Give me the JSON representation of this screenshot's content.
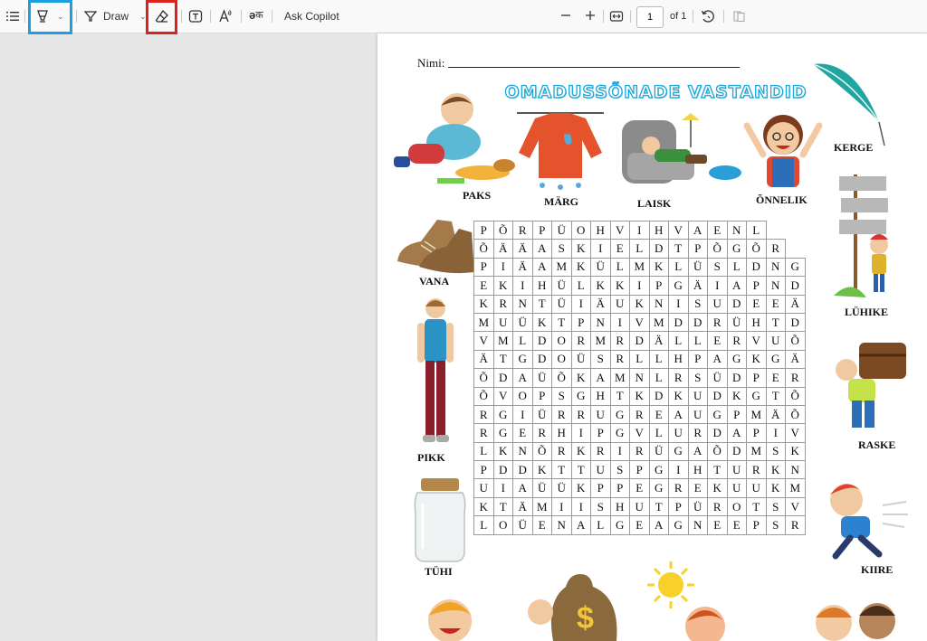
{
  "toolbar": {
    "draw_label": "Draw",
    "ask_copilot_label": "Ask Copilot",
    "page_number": "1",
    "page_total": "of 1",
    "highlight_color": "#1a9fe0",
    "eraser_highlight_color": "#e0201b"
  },
  "worksheet": {
    "name_label": "Nimi:",
    "title": "OMADUSSÕNADE VASTANDID",
    "title_color": "#1aa6d6",
    "labels": {
      "paks": "PAKS",
      "marg": "MÄRG",
      "laisk": "LAISK",
      "onnelik": "ÕNNELIK",
      "kerge": "KERGE",
      "vana": "VANA",
      "luhike": "LÜHIKE",
      "pikk": "PIKK",
      "raske": "RASKE",
      "tuhi": "TÜHI",
      "kiire": "KIIRE"
    },
    "grid": [
      [
        "P",
        "Õ",
        "R",
        "P",
        "Ü",
        "O",
        "H",
        "V",
        "I",
        "H",
        "V",
        "A",
        "E",
        "N",
        "L"
      ],
      [
        "Õ",
        "Ä",
        "Ä",
        "A",
        "S",
        "K",
        "I",
        "E",
        "L",
        "D",
        "T",
        "P",
        "Õ",
        "G",
        "Õ",
        "R"
      ],
      [
        "P",
        "I",
        "Ä",
        "A",
        "M",
        "K",
        "Ü",
        "L",
        "M",
        "K",
        "L",
        "Ü",
        "S",
        "L",
        "D",
        "N",
        "G"
      ],
      [
        "E",
        "K",
        "I",
        "H",
        "Ü",
        "L",
        "K",
        "K",
        "I",
        "P",
        "G",
        "Ä",
        "I",
        "A",
        "P",
        "N",
        "D"
      ],
      [
        "K",
        "R",
        "N",
        "T",
        "Ü",
        "I",
        "Ä",
        "U",
        "K",
        "N",
        "I",
        "S",
        "U",
        "D",
        "E",
        "E",
        "Ä"
      ],
      [
        "M",
        "U",
        "Ü",
        "K",
        "T",
        "P",
        "N",
        "I",
        "V",
        "M",
        "D",
        "D",
        "R",
        "Ü",
        "H",
        "T",
        "D"
      ],
      [
        "V",
        "M",
        "L",
        "D",
        "O",
        "R",
        "M",
        "R",
        "D",
        "Ä",
        "L",
        "L",
        "E",
        "R",
        "V",
        "U",
        "Õ"
      ],
      [
        "Ä",
        "T",
        "G",
        "D",
        "O",
        "Ü",
        "S",
        "R",
        "L",
        "L",
        "H",
        "P",
        "A",
        "G",
        "K",
        "G",
        "Ä"
      ],
      [
        "Õ",
        "D",
        "A",
        "Ü",
        "Õ",
        "K",
        "A",
        "M",
        "N",
        "L",
        "R",
        "S",
        "Ü",
        "D",
        "P",
        "E",
        "R"
      ],
      [
        "Õ",
        "V",
        "O",
        "P",
        "S",
        "G",
        "H",
        "T",
        "K",
        "D",
        "K",
        "U",
        "D",
        "K",
        "G",
        "T",
        "Õ"
      ],
      [
        "R",
        "G",
        "I",
        "Ü",
        "R",
        "R",
        "U",
        "G",
        "R",
        "E",
        "A",
        "U",
        "G",
        "P",
        "M",
        "Ä",
        "Õ"
      ],
      [
        "R",
        "G",
        "E",
        "R",
        "H",
        "I",
        "P",
        "G",
        "V",
        "L",
        "U",
        "R",
        "D",
        "A",
        "P",
        "I",
        "V"
      ],
      [
        "L",
        "K",
        "N",
        "Õ",
        "R",
        "K",
        "R",
        "I",
        "R",
        "Ü",
        "G",
        "A",
        "Õ",
        "D",
        "M",
        "S",
        "K"
      ],
      [
        "P",
        "D",
        "D",
        "K",
        "T",
        "T",
        "U",
        "S",
        "P",
        "G",
        "I",
        "H",
        "T",
        "U",
        "R",
        "K",
        "N"
      ],
      [
        "U",
        "I",
        "A",
        "Ü",
        "Ü",
        "K",
        "P",
        "P",
        "E",
        "G",
        "R",
        "E",
        "K",
        "U",
        "U",
        "K",
        "M"
      ],
      [
        "K",
        "T",
        "Ä",
        "M",
        "I",
        "I",
        "S",
        "H",
        "U",
        "T",
        "P",
        "Ü",
        "R",
        "O",
        "T",
        "S",
        "V"
      ],
      [
        "L",
        "O",
        "Ü",
        "E",
        "N",
        "A",
        "L",
        "G",
        "E",
        "A",
        "G",
        "N",
        "E",
        "E",
        "P",
        "S",
        "R"
      ]
    ]
  }
}
